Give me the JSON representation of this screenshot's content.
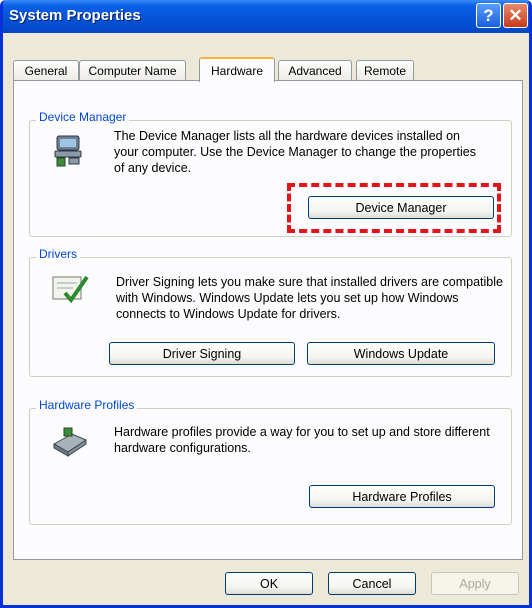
{
  "window": {
    "title": "System Properties",
    "help_glyph": "?",
    "close_glyph": "✕"
  },
  "tabs": [
    "General",
    "Computer Name",
    "Hardware",
    "Advanced",
    "Remote"
  ],
  "device_manager": {
    "group_title": "Device Manager",
    "description": "The Device Manager lists all the hardware devices installed on your computer. Use the Device Manager to change the properties of any device.",
    "button": "Device Manager",
    "icon": "device-manager-icon"
  },
  "drivers": {
    "group_title": "Drivers",
    "description": "Driver Signing lets you make sure that installed drivers are compatible with Windows. Windows Update lets you set up how Windows connects to Windows Update for drivers.",
    "driver_signing_button": "Driver Signing",
    "windows_update_button": "Windows Update",
    "icon": "driver-signing-icon"
  },
  "hardware_profiles": {
    "group_title": "Hardware Profiles",
    "description": "Hardware profiles provide a way for you to set up and store different hardware configurations.",
    "button": "Hardware Profiles",
    "icon": "hardware-profiles-icon"
  },
  "footer": {
    "ok": "OK",
    "cancel": "Cancel",
    "apply": "Apply"
  },
  "colors": {
    "title_bar": "#0553d6",
    "dialog_bg": "#ece9d8",
    "group_title": "#0046d5",
    "highlight": "#e5141b"
  }
}
